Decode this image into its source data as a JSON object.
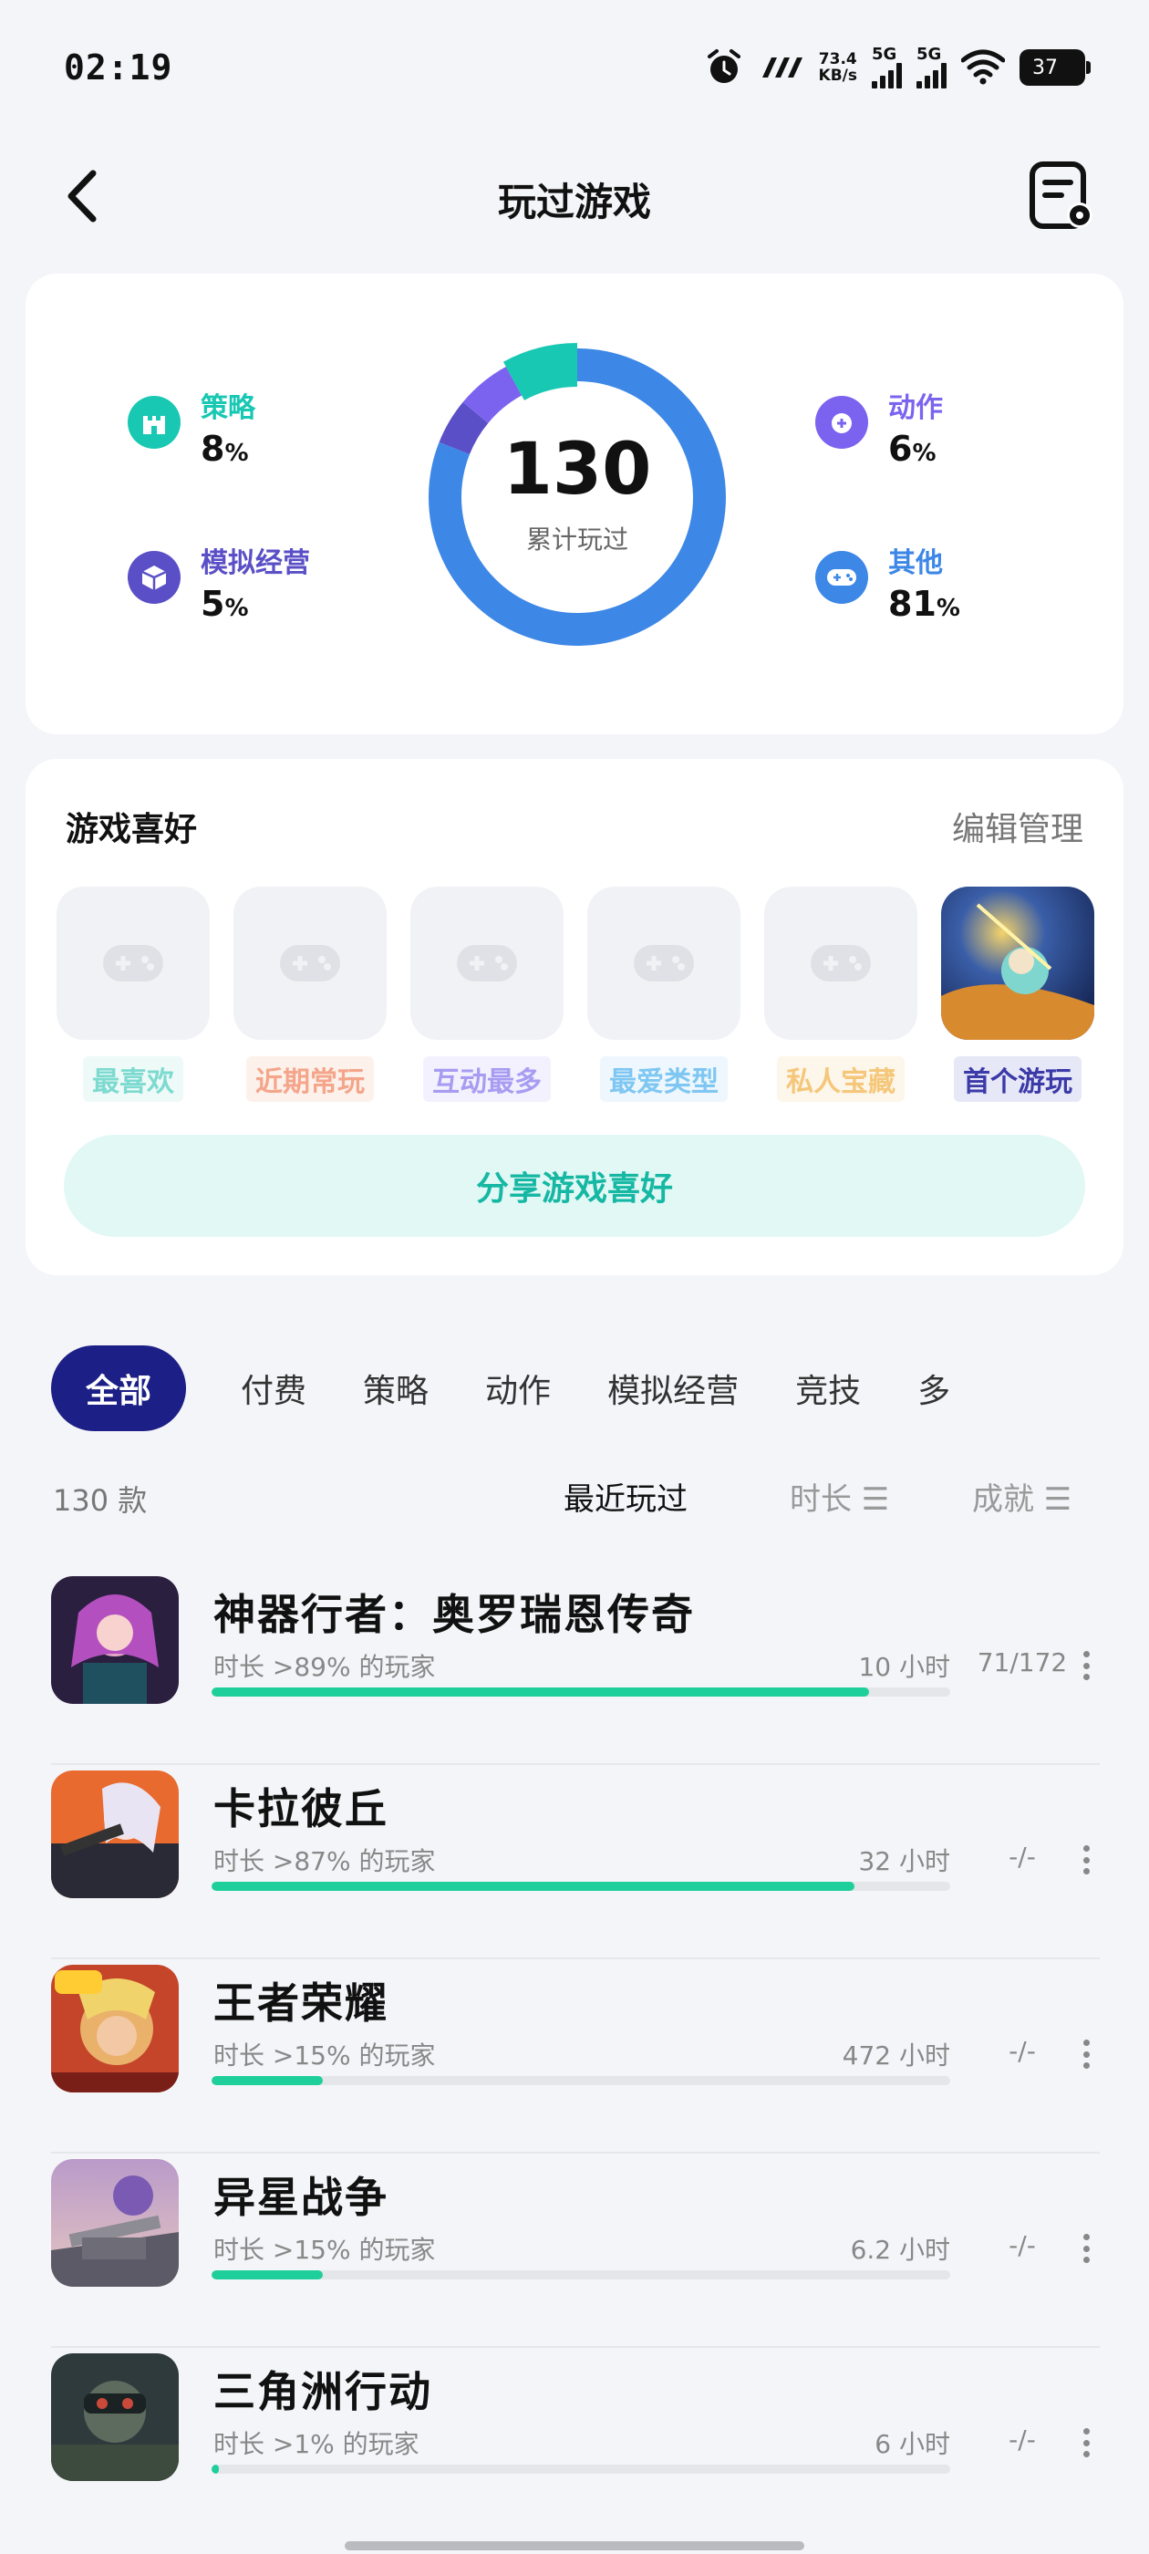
{
  "status_bar": {
    "time": "02:19",
    "net_speed_value": "73.4",
    "net_speed_unit": "KB/s",
    "signal1": "5G",
    "signal2": "5G",
    "battery": "37"
  },
  "header": {
    "title": "玩过游戏"
  },
  "summary": {
    "total": "130",
    "total_label": "累计玩过",
    "categories": [
      {
        "name": "策略",
        "percent": "8",
        "unit": "%",
        "color": "#18c8b3",
        "value": 8
      },
      {
        "name": "模拟经营",
        "percent": "5",
        "unit": "%",
        "color": "#5a4fc6",
        "value": 5
      },
      {
        "name": "动作",
        "percent": "6",
        "unit": "%",
        "color": "#7b63f0",
        "value": 6
      },
      {
        "name": "其他",
        "percent": "81",
        "unit": "%",
        "color": "#3d87e6",
        "value": 81
      }
    ]
  },
  "preferences": {
    "title": "游戏喜好",
    "edit_label": "编辑管理",
    "tiles": [
      {
        "label": "最喜欢",
        "color": "#7ddad0",
        "bg": "#eefaf8"
      },
      {
        "label": "近期常玩",
        "color": "#f4a58a",
        "bg": "#fdf1ec"
      },
      {
        "label": "互动最多",
        "color": "#a79cf2",
        "bg": "#f3f1fd"
      },
      {
        "label": "最爱类型",
        "color": "#7fc7f2",
        "bg": "#eef7fd"
      },
      {
        "label": "私人宝藏",
        "color": "#f5c77a",
        "bg": "#fdf6ea"
      },
      {
        "label": "首个游玩",
        "color": "#3b3aa8",
        "bg": "#e7e8f7"
      }
    ],
    "share_label": "分享游戏喜好"
  },
  "tabs": [
    "全部",
    "付费",
    "策略",
    "动作",
    "模拟经营",
    "竞技",
    "多"
  ],
  "sort": {
    "count": "130 款",
    "options": [
      "最近玩过",
      "时长 ☰",
      "成就 ☰"
    ]
  },
  "games": [
    {
      "name": "神器行者：奥罗瑞恩传奇",
      "percent_text": "时长 >89% 的玩家",
      "hours": "10 小时",
      "achievement": "71/172",
      "progress": 0.89
    },
    {
      "name": "卡拉彼丘",
      "percent_text": "时长 >87% 的玩家",
      "hours": "32 小时",
      "achievement": "-/-",
      "progress": 0.87
    },
    {
      "name": "王者荣耀",
      "percent_text": "时长 >15% 的玩家",
      "hours": "472 小时",
      "achievement": "-/-",
      "progress": 0.15
    },
    {
      "name": "异星战争",
      "percent_text": "时长 >15% 的玩家",
      "hours": "6.2 小时",
      "achievement": "-/-",
      "progress": 0.15
    },
    {
      "name": "三角洲行动",
      "percent_text": "时长 >1% 的玩家",
      "hours": "6 小时",
      "achievement": "-/-",
      "progress": 0.01
    }
  ]
}
